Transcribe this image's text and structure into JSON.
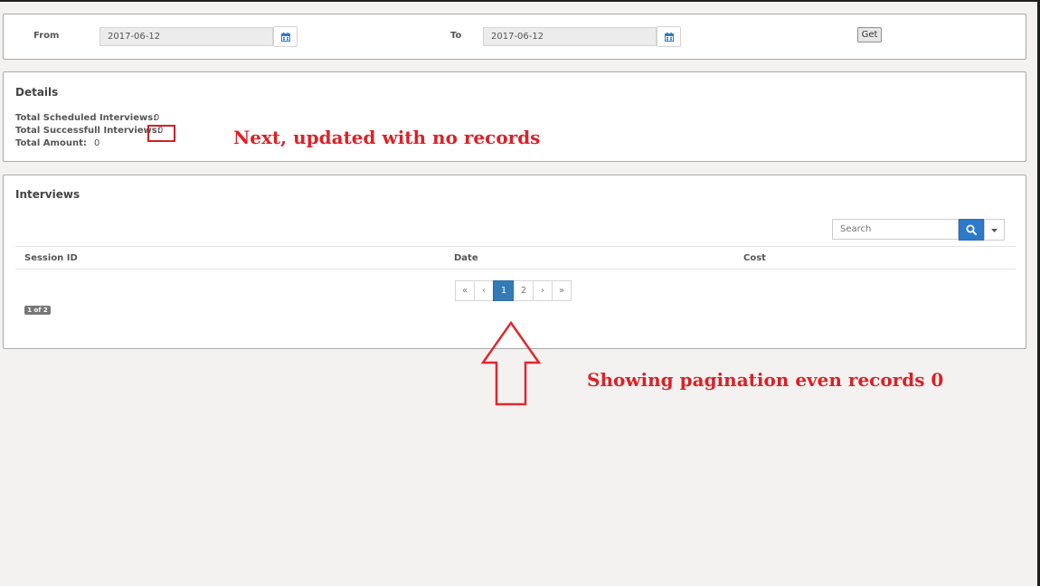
{
  "filter": {
    "from_label": "From",
    "from_value": "2017-06-12",
    "to_label": "To",
    "to_value": "2017-06-12",
    "get_label": "Get"
  },
  "details": {
    "title": "Details",
    "stats": [
      {
        "label": "Total Scheduled Interviews:",
        "value": "0"
      },
      {
        "label": "Total Successfull Interviews:",
        "value": "0"
      },
      {
        "label": "Total Amount:",
        "value": "0"
      }
    ]
  },
  "interviews": {
    "title": "Interviews",
    "search_placeholder": "Search",
    "columns": [
      "Session ID",
      "Date",
      "Cost"
    ],
    "pagination": [
      "«",
      "‹",
      "1",
      "2",
      "›",
      "»"
    ],
    "active_page": "1",
    "page_count": "1 of 2"
  },
  "annotations": {
    "details_note": "Next, updated with no records",
    "pagination_note": "Showing pagination even records 0"
  },
  "colors": {
    "accent": "#337ab7",
    "annotation_red": "#dc2127"
  },
  "icons": [
    "calendar-icon",
    "search-icon",
    "caret-down-icon"
  ]
}
